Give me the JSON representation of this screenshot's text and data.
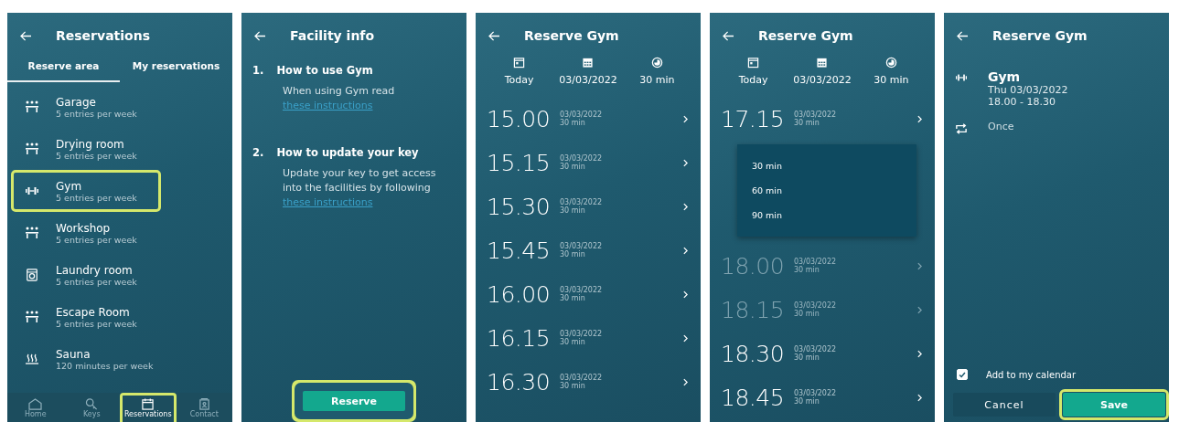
{
  "screens": [
    {
      "kind": "facility_list",
      "title": "Reservations",
      "tabs": [
        {
          "label": "Reserve area",
          "selected": true
        },
        {
          "label": "My reservations",
          "selected": false
        }
      ],
      "facilities": [
        {
          "name": "Garage",
          "quota": "5 entries per week",
          "kind": "people",
          "highlighted": false
        },
        {
          "name": "Drying room",
          "quota": "5 entries per week",
          "kind": "people",
          "highlighted": false
        },
        {
          "name": "Gym",
          "quota": "5 entries per week",
          "kind": "dumbbell",
          "highlighted": true
        },
        {
          "name": "Workshop",
          "quota": "5 entries per week",
          "kind": "people",
          "highlighted": false
        },
        {
          "name": "Laundry room",
          "quota": "5 entries per week",
          "kind": "washer",
          "highlighted": false
        },
        {
          "name": "Escape Room",
          "quota": "5 entries per week",
          "kind": "people",
          "highlighted": false
        },
        {
          "name": "Sauna",
          "quota": "120 minutes per week",
          "kind": "heat",
          "highlighted": false
        }
      ],
      "nav": [
        {
          "label": "Home",
          "kind": "home",
          "selected": false,
          "highlighted": false
        },
        {
          "label": "Keys",
          "kind": "key",
          "selected": false,
          "highlighted": false
        },
        {
          "label": "Reservations",
          "kind": "calendar",
          "selected": true,
          "highlighted": true
        },
        {
          "label": "Contact",
          "kind": "contact",
          "selected": false,
          "highlighted": false
        }
      ]
    },
    {
      "kind": "info",
      "title": "Facility info",
      "sections": [
        {
          "number": "1.",
          "heading": "How to use Gym",
          "text": "When using Gym read",
          "link": "these instructions"
        },
        {
          "number": "2.",
          "heading": "How to update your key",
          "text": "Update your key to get access into the facilities by following",
          "link": "these instructions"
        }
      ],
      "button": {
        "label": "Reserve",
        "highlighted": true
      }
    },
    {
      "kind": "slots",
      "title": "Reserve Gym",
      "filters": [
        {
          "kind": "day",
          "label": "Today"
        },
        {
          "kind": "date",
          "label": "03/03/2022"
        },
        {
          "kind": "duration",
          "label": "30 min"
        }
      ],
      "slots": [
        {
          "kind": "slot",
          "time": "15.00",
          "date": "03/03/2022",
          "duration": "30 min",
          "dimmed": false
        },
        {
          "kind": "slot",
          "time": "15.15",
          "date": "03/03/2022",
          "duration": "30 min",
          "dimmed": false
        },
        {
          "kind": "slot",
          "time": "15.30",
          "date": "03/03/2022",
          "duration": "30 min",
          "dimmed": false
        },
        {
          "kind": "slot",
          "time": "15.45",
          "date": "03/03/2022",
          "duration": "30 min",
          "dimmed": false
        },
        {
          "kind": "slot",
          "time": "16.00",
          "date": "03/03/2022",
          "duration": "30 min",
          "dimmed": false
        },
        {
          "kind": "slot",
          "time": "16.15",
          "date": "03/03/2022",
          "duration": "30 min",
          "dimmed": false
        },
        {
          "kind": "slot",
          "time": "16.30",
          "date": "03/03/2022",
          "duration": "30 min",
          "dimmed": false
        }
      ]
    },
    {
      "kind": "slots",
      "title": "Reserve Gym",
      "filters": [
        {
          "kind": "day",
          "label": "Today"
        },
        {
          "kind": "date",
          "label": "03/03/2022"
        },
        {
          "kind": "duration",
          "label": "30 min"
        }
      ],
      "slots": [
        {
          "kind": "slot",
          "time": "17.15",
          "date": "03/03/2022",
          "duration": "30 min",
          "dimmed": false
        },
        {
          "kind": "menu",
          "options": [
            "30 min",
            "60 min",
            "90 min"
          ]
        },
        {
          "kind": "slot",
          "time": "18.00",
          "date": "03/03/2022",
          "duration": "30 min",
          "dimmed": true
        },
        {
          "kind": "slot",
          "time": "18.15",
          "date": "03/03/2022",
          "duration": "30 min",
          "dimmed": true
        },
        {
          "kind": "slot",
          "time": "18.30",
          "date": "03/03/2022",
          "duration": "30 min",
          "dimmed": false
        },
        {
          "kind": "slot",
          "time": "18.45",
          "date": "03/03/2022",
          "duration": "30 min",
          "dimmed": false
        }
      ]
    },
    {
      "kind": "confirm",
      "title": "Reserve Gym",
      "facility": "Gym",
      "date": "Thu 03/03/2022",
      "time": "18.00 - 18.30",
      "repeat": "Once",
      "calendar": {
        "label": "Add to my calendar",
        "checked": true
      },
      "buttons": [
        {
          "label": "Cancel",
          "kind": "secondary",
          "highlighted": false
        },
        {
          "label": "Save",
          "kind": "primary",
          "highlighted": true
        }
      ]
    }
  ]
}
